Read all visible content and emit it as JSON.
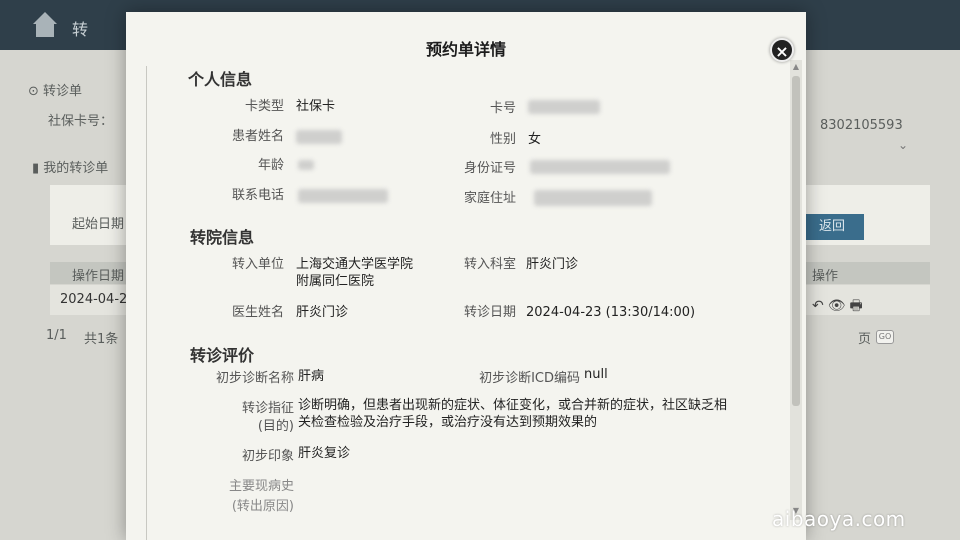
{
  "modal": {
    "title": "预约单详情",
    "close_label": "×"
  },
  "personal": {
    "section_title": "个人信息",
    "card_type_label": "卡类型",
    "card_type_value": "社保卡",
    "card_no_label": "卡号",
    "patient_name_label": "患者姓名",
    "gender_label": "性别",
    "gender_value": "女",
    "age_label": "年龄",
    "id_no_label": "身份证号",
    "phone_label": "联系电话",
    "address_label": "家庭住址"
  },
  "transfer": {
    "section_title": "转院信息",
    "unit_label": "转入单位",
    "unit_value": "上海交通大学医学院附属同仁医院",
    "dept_label": "转入科室",
    "dept_value": "肝炎门诊",
    "doctor_label": "医生姓名",
    "doctor_value": "肝炎门诊",
    "date_label": "转诊日期",
    "date_value": "2024-04-23 (13:30/14:00)"
  },
  "evaluation": {
    "section_title": "转诊评价",
    "diag_name_label": "初步诊断名称",
    "diag_name_value": "肝病",
    "icd_label": "初步诊断ICD编码",
    "icd_value": "null",
    "indication_label": "转诊指征",
    "indication_label_sub": "(目的)",
    "indication_value": "诊断明确，但患者出现新的症状、体征变化，或合并新的症状，社区缺乏相关检查检验及治疗手段，或治疗没有达到预期效果的",
    "impression_label": "初步印象",
    "impression_value": "肝炎复诊",
    "history_label": "主要现病史",
    "history_label_sub": "(转出原因)"
  },
  "background": {
    "header_text": "转",
    "referral_label": "转诊单",
    "insurance_card_label": "社保卡号：",
    "my_referrals": "我的转诊单",
    "start_date_label": "起始日期",
    "return_button": "返回",
    "op_date_header": "操作日期",
    "op_header": "操作",
    "row_date": "2024-04-2",
    "pager": "1/1",
    "total": "共1条",
    "page_label": "页",
    "go_label": "GO",
    "card_partial": "8302105593"
  },
  "watermark": "aibaoya.com"
}
